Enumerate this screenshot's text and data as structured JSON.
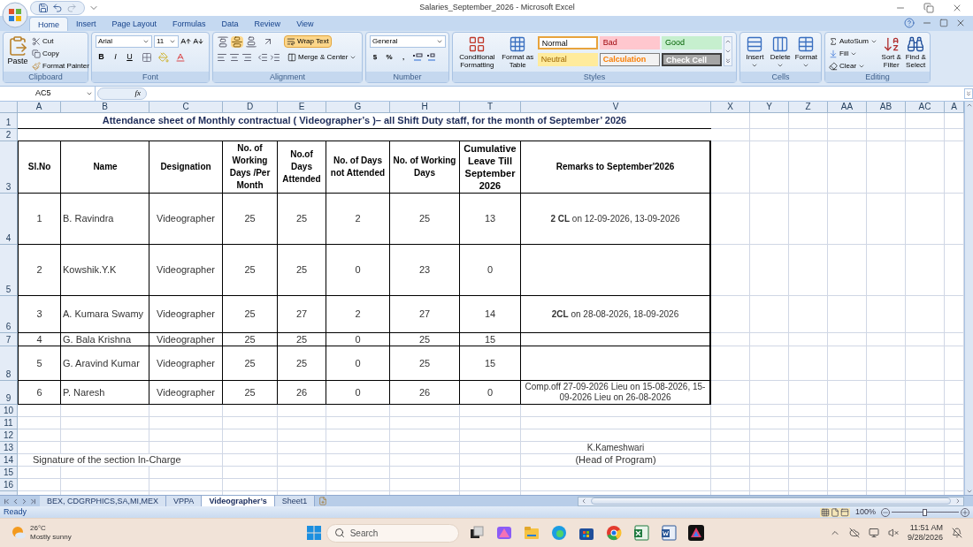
{
  "window": {
    "title": "Salaries_September_2026 - Microsoft Excel"
  },
  "ribbon_tabs": [
    {
      "label": "Home",
      "selected": true
    },
    {
      "label": "Insert",
      "selected": false
    },
    {
      "label": "Page Layout",
      "selected": false
    },
    {
      "label": "Formulas",
      "selected": false
    },
    {
      "label": "Data",
      "selected": false
    },
    {
      "label": "Review",
      "selected": false
    },
    {
      "label": "View",
      "selected": false
    }
  ],
  "clipboard": {
    "paste": "Paste",
    "cut": "Cut",
    "copy": "Copy",
    "format_painter": "Format Painter",
    "label": "Clipboard"
  },
  "font": {
    "name": "Arial",
    "size": "11",
    "bold": "B",
    "italic": "I",
    "underline": "U",
    "label": "Font"
  },
  "alignment": {
    "vertical_align": [
      {
        "selected": false
      },
      {
        "selected": true
      },
      {
        "selected": false
      }
    ],
    "wrap_text": {
      "label": "Wrap Text",
      "on": true
    },
    "merge_center": "Merge & Center",
    "label": "Alignment"
  },
  "number": {
    "format": "General",
    "buttons": [
      "$",
      "%",
      ","
    ],
    "label": "Number"
  },
  "styles": {
    "conditional": "Conditional Formatting",
    "format_table": "Format as Table",
    "label": "Styles",
    "cell_styles": [
      {
        "label": "Normal",
        "kind": "normal"
      },
      {
        "label": "Bad",
        "kind": "bad"
      },
      {
        "label": "Good",
        "kind": "good"
      },
      {
        "label": "Neutral",
        "kind": "neutral"
      },
      {
        "label": "Calculation",
        "kind": "calculation"
      },
      {
        "label": "Check Cell",
        "kind": "check"
      }
    ]
  },
  "cells": {
    "buttons": [
      "Insert",
      "Delete",
      "Format"
    ],
    "label": "Cells"
  },
  "editing": {
    "autosum": "AutoSum",
    "fill": "Fill",
    "clear": "Clear",
    "sort": "Sort & Filter",
    "find": "Find & Select",
    "label": "Editing"
  },
  "formula_bar": {
    "name_box": "AC5",
    "fx": "fx"
  },
  "column_headers": [
    "A",
    "B",
    "C",
    "D",
    "E",
    "G",
    "H",
    "T",
    "V",
    "X",
    "Y",
    "Z",
    "AA",
    "AB",
    "AC",
    "A"
  ],
  "row_numbers": [
    "1",
    "2",
    "3",
    "4",
    "5",
    "6",
    "7",
    "8",
    "9",
    "10",
    "11",
    "12",
    "13",
    "14",
    "15",
    "16"
  ],
  "sheet": {
    "title": "Attendance sheet of Monthly contractual ( Videographer’s )– all Shift Duty staff, for the month of September’ 2026",
    "headers": [
      "Sl.No",
      "Name",
      "Designation",
      "No. of Working Days /Per Month",
      "No.of Days Attended",
      "No. of Days not Attended",
      "No. of Working Days",
      "Cumulative Leave Till September 2026",
      "Remarks to September'2026"
    ],
    "rows": [
      {
        "sl": "1",
        "name": "B. Ravindra",
        "designation": "Videographer",
        "working_days": "25",
        "attended": "25",
        "not_attended": "2",
        "working": "25",
        "leave": "13",
        "remarks": "**2 CL** on 12-09-2026, 13-09-2026"
      },
      {
        "sl": "2",
        "name": "Kowshik.Y.K",
        "designation": "Videographer",
        "working_days": "25",
        "attended": "25",
        "not_attended": "0",
        "working": "23",
        "leave": "0"
      },
      {
        "sl": "3",
        "name": "A. Kumara Swamy",
        "designation": "Videographer",
        "working_days": "25",
        "attended": "27",
        "not_attended": "2",
        "working": "27",
        "leave": "14",
        "remarks": "**2CL** on 28-08-2026, 18-09-2026"
      },
      {
        "sl": "4",
        "name": "G. Bala Krishna",
        "designation": "Videographer",
        "working_days": "25",
        "attended": "25",
        "not_attended": "0",
        "working": "25",
        "leave": "15"
      },
      {
        "sl": "5",
        "name": "G. Aravind Kumar",
        "designation": "Videographer",
        "working_days": "25",
        "attended": "25",
        "not_attended": "0",
        "working": "25",
        "leave": "15"
      },
      {
        "sl": "6",
        "name": "P. Naresh",
        "designation": "Videographer",
        "working_days": "25",
        "attended": "26",
        "not_attended": "0",
        "working": "26",
        "leave": "0",
        "remarks": "Comp.off 27-09-2026 Lieu on 15-08-2026, 15-09-2026 Lieu on 26-08-2026"
      }
    ],
    "signatory": "K.Kameshwari",
    "signatory_role": "(Head of Program)",
    "signature": "Signature of the section In-Charge"
  },
  "sheet_tabs": [
    {
      "label": "BEX, CDGRPHICS,SA,MI,MEX",
      "selected": false
    },
    {
      "label": "VPPA",
      "selected": false
    },
    {
      "label": "Videographer’s",
      "selected": true
    },
    {
      "label": "Sheet1",
      "selected": false
    }
  ],
  "status_bar": {
    "mode": "Ready",
    "zoom": "100%",
    "zoom_slider": {
      "level": 0.5
    }
  },
  "taskbar": {
    "temperature": "26°C",
    "weather": "Mostly sunny",
    "search_placeholder": "Search",
    "time": "11:51 AM",
    "date": "9/28/2026"
  }
}
